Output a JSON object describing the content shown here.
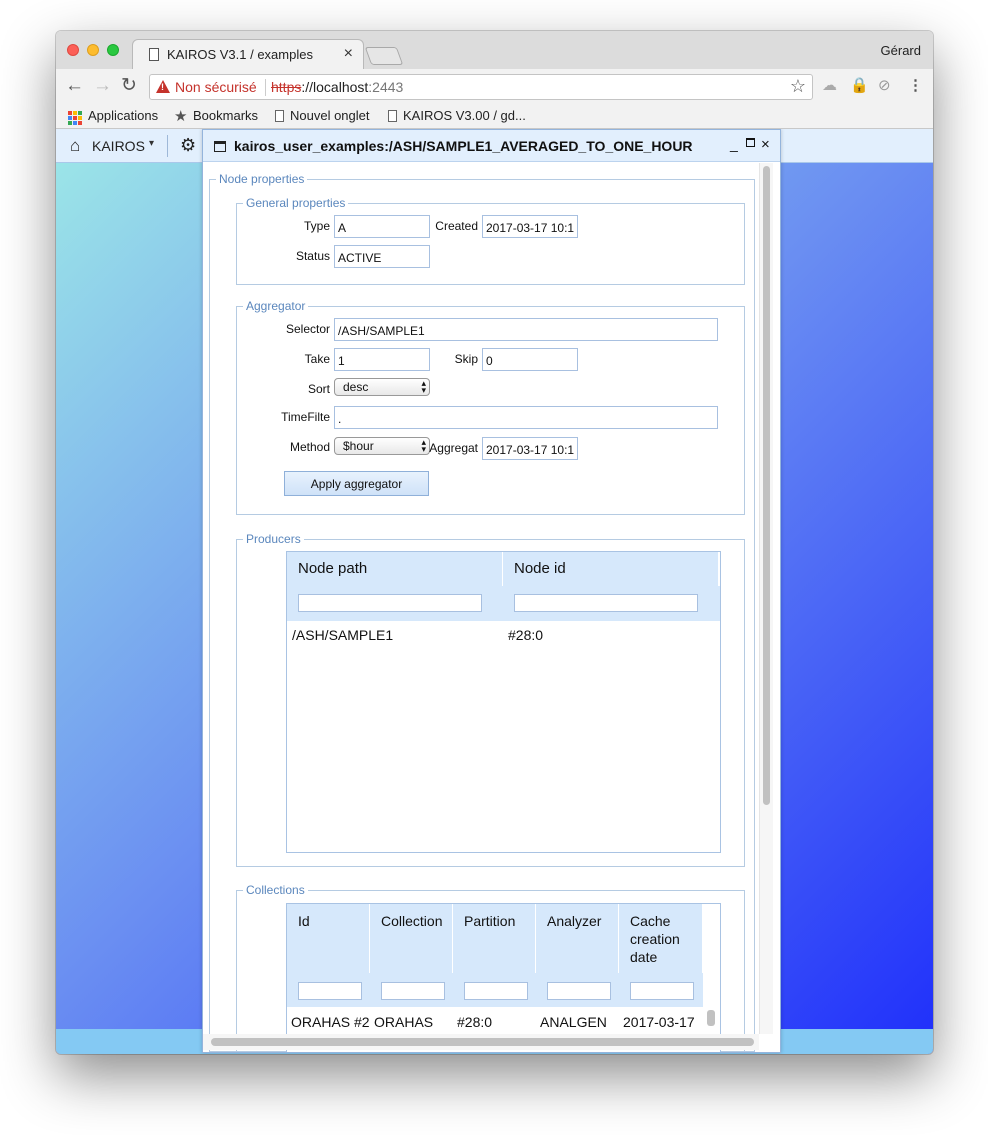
{
  "browser": {
    "tab_title": "KAIROS V3.1 / examples",
    "tab_close": "×",
    "user": "Gérard",
    "nav": {
      "back": "←",
      "forward": "→",
      "reload": "↻"
    },
    "security_label": "Non sécurisé",
    "url_proto": "https",
    "url_sep": "://",
    "url_host": "localhost",
    "url_port": ":2443",
    "star": "☆",
    "ext": {
      "drive": "☁",
      "lock": "🔒",
      "compass": "⊘",
      "menu": "⋮"
    },
    "bookmarks": [
      {
        "label": "Applications"
      },
      {
        "label": "Bookmarks"
      },
      {
        "label": "Nouvel onglet"
      },
      {
        "label": "KAIROS V3.00 / gd..."
      }
    ],
    "apps_colors": [
      "#ea4335",
      "#fbbc05",
      "#34a853",
      "#4285f4",
      "#ea4335",
      "#fbbc05",
      "#34a853",
      "#4285f4",
      "#ea4335"
    ]
  },
  "app": {
    "home_icon": "⌂",
    "name": "KAIROS",
    "caret": "▾",
    "gear": "⚙"
  },
  "dialog": {
    "title": "kairos_user_examples:/ASH/SAMPLE1_AVERAGED_TO_ONE_HOUR",
    "min": "_",
    "close": "×",
    "node_properties": "Node properties",
    "general": {
      "legend": "General properties",
      "type_label": "Type",
      "type_value": "A",
      "created_label": "Created",
      "created_value": "2017-03-17 10:1",
      "status_label": "Status",
      "status_value": "ACTIVE"
    },
    "aggregator": {
      "legend": "Aggregator",
      "selector_label": "Selector",
      "selector_value": "/ASH/SAMPLE1",
      "take_label": "Take",
      "take_value": "1",
      "skip_label": "Skip",
      "skip_value": "0",
      "sort_label": "Sort",
      "sort_value": "desc",
      "timefilter_label": "TimeFilte",
      "timefilter_value": ".",
      "method_label": "Method",
      "method_value": "$hour",
      "aggregat_label": "Aggregat",
      "aggregat_value": "2017-03-17 10:1",
      "apply_button": "Apply aggregator"
    },
    "producers": {
      "legend": "Producers",
      "columns": [
        "Node path",
        "Node id"
      ],
      "rows": [
        [
          "/ASH/SAMPLE1",
          "#28:0"
        ]
      ]
    },
    "collections": {
      "legend": "Collections",
      "columns": [
        "Id",
        "Collection",
        "Partition",
        "Analyzer",
        "Cache creation date"
      ],
      "rows": [
        [
          "ORAHAS #2",
          "ORAHAS",
          "#28:0",
          "ANALGEN",
          "2017-03-17"
        ]
      ]
    }
  }
}
